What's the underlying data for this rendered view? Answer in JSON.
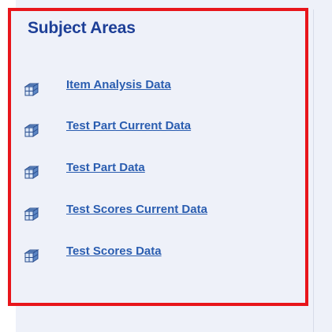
{
  "panel": {
    "title": "Subject Areas",
    "items": [
      {
        "label": "Item Analysis Data",
        "icon": "cube-icon"
      },
      {
        "label": "Test Part Current Data",
        "icon": "cube-icon"
      },
      {
        "label": "Test Part Data",
        "icon": "cube-icon"
      },
      {
        "label": "Test Scores Current Data",
        "icon": "cube-icon"
      },
      {
        "label": "Test Scores Data",
        "icon": "cube-icon"
      }
    ]
  },
  "colors": {
    "highlight_border": "#e8151b",
    "title": "#1d3f97",
    "link": "#2a5db0",
    "panel_background": "#eef1f9"
  }
}
